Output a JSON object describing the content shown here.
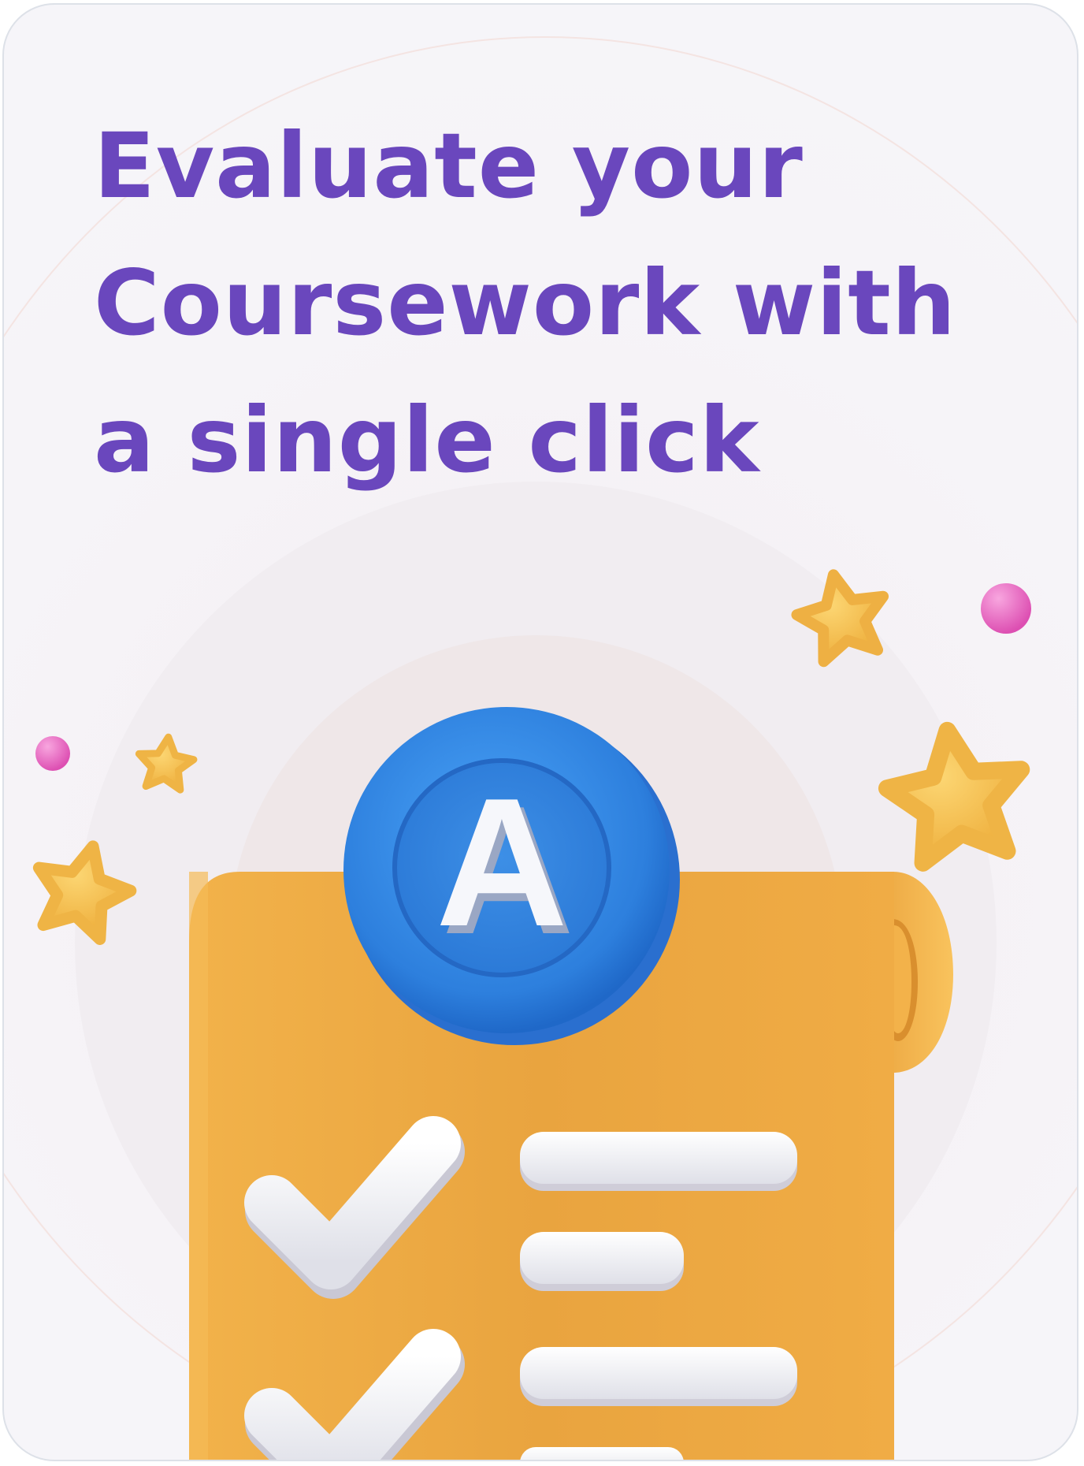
{
  "headline": {
    "line1": "Evaluate your",
    "line2": "Coursework with",
    "line3": "a single click"
  },
  "badge": {
    "grade": "A"
  },
  "colors": {
    "headline": "#6a47bd",
    "scroll": "#f1ad43",
    "badge": "#2f86e0",
    "star": "#f7c24c",
    "dot": "#e96bc4",
    "line": "#f5f5f7"
  },
  "icons": [
    "star-icon",
    "dot-icon",
    "grade-badge-icon",
    "checkmark-icon",
    "scroll-document-icon"
  ]
}
